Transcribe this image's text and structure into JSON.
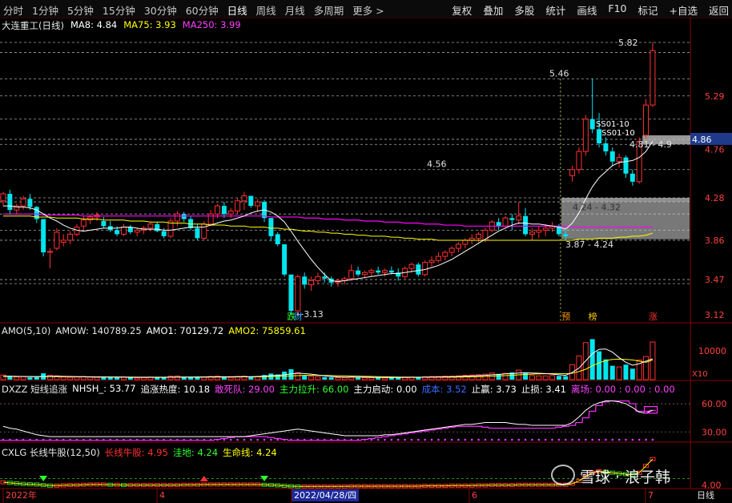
{
  "toolbar": {
    "periods": [
      "分时",
      "1分钟",
      "5分钟",
      "15分钟",
      "30分钟",
      "60分钟",
      "日线",
      "周线",
      "月线",
      "多周期",
      "更多 >"
    ],
    "active_period": "日线",
    "right_tools": [
      "复权",
      "叠加",
      "多股",
      "统计",
      "画线",
      "F10",
      "标记",
      "+自选",
      "返回"
    ]
  },
  "main_panel": {
    "stock_name": "大连重工(日线)",
    "ma8_label": "MA8: 4.84",
    "ma75_label": "MA75: 3.93",
    "ma250_label": "MA250: 3.99",
    "price_axis": [
      "5.29",
      "4.76",
      "4.28",
      "3.86",
      "3.47",
      "3.12"
    ],
    "current_price": "4.86",
    "ann_high": "5.82",
    "ann_546": "5.46",
    "ann_456": "4.56",
    "ann_low": "3.13",
    "ann_s1": "SS01-10",
    "ann_s2": "SS01-10",
    "ann_range1": "4.24 - 4.32",
    "ann_range2": "3.87 - 4.24",
    "ann_range3": "4.81 - 4.9",
    "tag_die": "跌",
    "tag_cai": "财",
    "tag_yu": "预",
    "tag_bang": "榜",
    "tag_zhang": "涨"
  },
  "amo_panel": {
    "title": "AMO(5,10)",
    "amow": "AMOW: 140789.25",
    "amo1": "AMO1: 70129.72",
    "amo2": "AMO2: 75859.61",
    "axis_label": "10000",
    "unit": "X10"
  },
  "dxzz_panel": {
    "title": "DXZZ 短线追涨",
    "nhsh": "NHSH_: 53.77",
    "zzrd": "追涨热度: 10.18",
    "gsj": "敢死队: 29.00",
    "zlls": "主力拉升: 66.00",
    "zlqd": "主力启动: 0.00",
    "cb": "成本: 3.52",
    "zy": "止赢: 3.73",
    "zs": "止损: 3.41",
    "lc": "离场: 0.00 : 0.00 : 0.00",
    "axis": [
      "60.00",
      "30.00"
    ]
  },
  "cxlg_panel": {
    "title": "CXLG 长线牛股(12,50)",
    "cxng": "长线牛股: 4.95",
    "wd": "洼地: 4.24",
    "smx": "生命线: 4.24",
    "axis": "4.00"
  },
  "xaxis": {
    "labels": [
      "2022年",
      "4",
      "2022/04/28/四",
      "6",
      "7"
    ],
    "period": "日线"
  },
  "watermark": "雪球 · 浪子韩",
  "colors": {
    "up": "#ff3030",
    "down": "#00e5ee",
    "ma8": "#ffffff",
    "ma75": "#ffff00",
    "ma250": "#ff00ff"
  },
  "chart_data": {
    "type": "candlestick",
    "candles": [
      [
        4.25,
        4.34,
        4.2,
        4.32
      ],
      [
        4.32,
        4.36,
        4.12,
        4.16
      ],
      [
        4.16,
        4.22,
        4.12,
        4.2
      ],
      [
        4.2,
        4.3,
        4.16,
        4.27
      ],
      [
        4.27,
        4.32,
        4.16,
        4.19
      ],
      [
        4.19,
        4.2,
        4.03,
        4.07
      ],
      [
        4.07,
        4.07,
        3.7,
        3.74
      ],
      [
        3.74,
        3.78,
        3.58,
        3.75
      ],
      [
        3.78,
        3.98,
        3.76,
        3.94
      ],
      [
        3.84,
        3.92,
        3.8,
        3.86
      ],
      [
        3.86,
        3.95,
        3.82,
        3.92
      ],
      [
        3.92,
        4.02,
        3.9,
        3.99
      ],
      [
        4.0,
        4.1,
        3.96,
        4.06
      ],
      [
        4.06,
        4.12,
        4.02,
        4.09
      ],
      [
        4.09,
        4.14,
        4.05,
        4.11
      ],
      [
        4.05,
        4.09,
        3.98,
        4.0
      ],
      [
        4.0,
        4.05,
        3.94,
        3.96
      ],
      [
        3.96,
        4.0,
        3.9,
        3.92
      ],
      [
        3.92,
        4.02,
        3.9,
        3.99
      ],
      [
        3.99,
        4.01,
        3.92,
        3.94
      ],
      [
        3.94,
        3.98,
        3.9,
        3.96
      ],
      [
        3.96,
        4.0,
        3.92,
        3.98
      ],
      [
        3.98,
        4.04,
        3.95,
        4.02
      ],
      [
        4.02,
        4.04,
        3.94,
        3.95
      ],
      [
        3.95,
        3.98,
        3.88,
        3.9
      ],
      [
        3.9,
        4.08,
        3.88,
        4.05
      ],
      [
        4.05,
        4.15,
        4.0,
        4.12
      ],
      [
        4.12,
        4.14,
        4.04,
        4.07
      ],
      [
        4.07,
        4.1,
        3.96,
        3.98
      ],
      [
        3.98,
        4.02,
        3.86,
        3.88
      ],
      [
        3.88,
        4.05,
        3.86,
        4.02
      ],
      [
        4.02,
        4.16,
        4.0,
        4.12
      ],
      [
        4.12,
        4.22,
        4.08,
        4.2
      ],
      [
        4.2,
        4.24,
        4.08,
        4.12
      ],
      [
        4.12,
        4.18,
        4.08,
        4.15
      ],
      [
        4.15,
        4.28,
        4.12,
        4.25
      ],
      [
        4.25,
        4.34,
        4.16,
        4.3
      ],
      [
        4.3,
        4.3,
        4.18,
        4.2
      ],
      [
        4.2,
        4.27,
        4.14,
        4.24
      ],
      [
        4.24,
        4.26,
        4.04,
        4.08
      ],
      [
        4.08,
        4.08,
        3.85,
        3.9
      ],
      [
        3.92,
        3.94,
        3.8,
        3.82
      ],
      [
        3.82,
        3.82,
        3.5,
        3.52
      ],
      [
        3.52,
        3.52,
        3.12,
        3.16
      ],
      [
        3.16,
        3.52,
        3.13,
        3.5
      ],
      [
        3.5,
        3.54,
        3.38,
        3.42
      ],
      [
        3.42,
        3.5,
        3.36,
        3.46
      ],
      [
        3.46,
        3.54,
        3.42,
        3.5
      ],
      [
        3.5,
        3.54,
        3.44,
        3.48
      ],
      [
        3.48,
        3.5,
        3.4,
        3.44
      ],
      [
        3.44,
        3.48,
        3.4,
        3.46
      ],
      [
        3.46,
        3.5,
        3.42,
        3.48
      ],
      [
        3.48,
        3.62,
        3.46,
        3.56
      ],
      [
        3.56,
        3.6,
        3.5,
        3.52
      ],
      [
        3.52,
        3.56,
        3.48,
        3.54
      ],
      [
        3.54,
        3.58,
        3.5,
        3.56
      ],
      [
        3.56,
        3.6,
        3.52,
        3.54
      ],
      [
        3.54,
        3.58,
        3.5,
        3.56
      ],
      [
        3.56,
        3.6,
        3.52,
        3.54
      ],
      [
        3.54,
        3.58,
        3.46,
        3.5
      ],
      [
        3.5,
        3.6,
        3.48,
        3.58
      ],
      [
        3.58,
        3.64,
        3.54,
        3.62
      ],
      [
        3.62,
        3.64,
        3.5,
        3.52
      ],
      [
        3.52,
        3.66,
        3.5,
        3.64
      ],
      [
        3.64,
        3.7,
        3.6,
        3.66
      ],
      [
        3.66,
        3.74,
        3.64,
        3.7
      ],
      [
        3.7,
        3.76,
        3.66,
        3.74
      ],
      [
        3.74,
        3.8,
        3.7,
        3.78
      ],
      [
        3.78,
        3.84,
        3.74,
        3.82
      ],
      [
        3.82,
        3.88,
        3.78,
        3.86
      ],
      [
        3.86,
        3.92,
        3.82,
        3.88
      ],
      [
        3.88,
        3.94,
        3.84,
        3.92
      ],
      [
        3.86,
        3.98,
        3.84,
        3.96
      ],
      [
        3.96,
        4.06,
        3.94,
        4.04
      ],
      [
        4.04,
        4.08,
        3.96,
        4.0
      ],
      [
        4.0,
        4.1,
        3.98,
        4.08
      ],
      [
        4.08,
        4.12,
        3.96,
        4.06
      ],
      [
        4.06,
        4.24,
        4.02,
        4.1
      ],
      [
        4.1,
        4.18,
        3.9,
        3.92
      ],
      [
        3.92,
        3.98,
        3.86,
        3.94
      ],
      [
        3.94,
        4.0,
        3.88,
        3.96
      ],
      [
        3.96,
        4.02,
        3.9,
        3.98
      ],
      [
        3.98,
        4.04,
        3.94,
        4.0
      ],
      [
        4.0,
        4.02,
        3.9,
        3.92
      ],
      [
        3.92,
        3.96,
        3.86,
        3.9
      ],
      [
        4.5,
        4.6,
        4.44,
        4.56
      ],
      [
        4.56,
        4.78,
        4.52,
        4.74
      ],
      [
        4.74,
        5.1,
        4.7,
        5.06
      ],
      [
        5.06,
        5.46,
        4.92,
        4.96
      ],
      [
        4.96,
        5.12,
        4.78,
        4.82
      ],
      [
        4.82,
        4.88,
        4.7,
        4.74
      ],
      [
        4.74,
        4.78,
        4.6,
        4.64
      ],
      [
        4.64,
        4.72,
        4.58,
        4.68
      ],
      [
        4.68,
        4.7,
        4.48,
        4.52
      ],
      [
        4.52,
        4.56,
        4.4,
        4.44
      ],
      [
        4.44,
        4.88,
        4.42,
        4.84
      ],
      [
        4.9,
        5.26,
        4.86,
        5.2
      ],
      [
        5.2,
        5.82,
        5.18,
        5.74
      ]
    ],
    "ma8": [
      4.2,
      4.2,
      4.19,
      4.19,
      4.18,
      4.16,
      4.12,
      4.08,
      4.05,
      4.01,
      3.98,
      3.96,
      3.95,
      3.96,
      3.97,
      3.98,
      3.98,
      3.98,
      3.99,
      3.99,
      3.98,
      3.97,
      3.97,
      3.97,
      3.96,
      3.96,
      3.97,
      3.98,
      3.99,
      3.99,
      3.99,
      4.01,
      4.03,
      4.05,
      4.06,
      4.08,
      4.1,
      4.13,
      4.15,
      4.16,
      4.14,
      4.1,
      4.04,
      3.95,
      3.85,
      3.76,
      3.67,
      3.59,
      3.52,
      3.46,
      3.45,
      3.46,
      3.47,
      3.48,
      3.49,
      3.5,
      3.51,
      3.52,
      3.53,
      3.53,
      3.54,
      3.55,
      3.56,
      3.57,
      3.59,
      3.61,
      3.64,
      3.67,
      3.71,
      3.75,
      3.79,
      3.83,
      3.87,
      3.91,
      3.95,
      3.98,
      4.01,
      4.03,
      4.03,
      4.02,
      4.02,
      4.01,
      4.0,
      3.99,
      3.97,
      4.03,
      4.13,
      4.27,
      4.39,
      4.48,
      4.54,
      4.6,
      4.63,
      4.64,
      4.65,
      4.68,
      4.74,
      4.84
    ],
    "ma75": [
      4.1,
      4.1,
      4.1,
      4.1,
      4.1,
      4.09,
      4.09,
      4.09,
      4.08,
      4.08,
      4.08,
      4.08,
      4.07,
      4.07,
      4.07,
      4.06,
      4.06,
      4.06,
      4.06,
      4.05,
      4.05,
      4.05,
      4.04,
      4.04,
      4.04,
      4.03,
      4.03,
      4.03,
      4.02,
      4.02,
      4.02,
      4.01,
      4.01,
      4.01,
      4.0,
      4.0,
      4.0,
      3.99,
      3.99,
      3.99,
      3.98,
      3.98,
      3.97,
      3.97,
      3.96,
      3.95,
      3.95,
      3.94,
      3.94,
      3.93,
      3.93,
      3.92,
      3.92,
      3.91,
      3.91,
      3.9,
      3.9,
      3.9,
      3.89,
      3.89,
      3.88,
      3.88,
      3.87,
      3.87,
      3.87,
      3.86,
      3.86,
      3.86,
      3.86,
      3.86,
      3.86,
      3.86,
      3.86,
      3.86,
      3.86,
      3.86,
      3.86,
      3.86,
      3.86,
      3.86,
      3.86,
      3.86,
      3.86,
      3.86,
      3.86,
      3.86,
      3.87,
      3.87,
      3.87,
      3.88,
      3.88,
      3.88,
      3.89,
      3.89,
      3.9,
      3.9,
      3.91,
      3.93
    ],
    "ma250": [
      4.12,
      4.12,
      4.12,
      4.12,
      4.12,
      4.12,
      4.11,
      4.11,
      4.11,
      4.11,
      4.11,
      4.11,
      4.1,
      4.1,
      4.1,
      4.1,
      4.1,
      4.1,
      4.1,
      4.1,
      4.1,
      4.1,
      4.1,
      4.1,
      4.1,
      4.1,
      4.1,
      4.1,
      4.1,
      4.1,
      4.1,
      4.1,
      4.1,
      4.1,
      4.1,
      4.1,
      4.1,
      4.1,
      4.1,
      4.1,
      4.09,
      4.09,
      4.09,
      4.09,
      4.09,
      4.08,
      4.08,
      4.08,
      4.07,
      4.07,
      4.07,
      4.06,
      4.06,
      4.06,
      4.05,
      4.05,
      4.05,
      4.04,
      4.04,
      4.04,
      4.03,
      4.03,
      4.03,
      4.02,
      4.02,
      4.02,
      4.01,
      4.01,
      4.01,
      4.0,
      4.0,
      4.0,
      4.0,
      4.0,
      4.0,
      4.0,
      4.0,
      4.0,
      4.0,
      4.0,
      4.0,
      4.0,
      4.0,
      4.0,
      4.0,
      3.99,
      3.99,
      3.99,
      3.99,
      3.99,
      3.99,
      3.99,
      3.99,
      3.99,
      3.99,
      3.99,
      3.99,
      3.99
    ],
    "price_range": [
      3.05,
      6.05
    ],
    "hlines": [
      5.82,
      5.72,
      5.46,
      5.29,
      5.06,
      4.86,
      4.81,
      4.56,
      4.28,
      4.24,
      4.12,
      3.96,
      3.86,
      3.47,
      3.43
    ],
    "volume_range": [
      0,
      15500
    ],
    "volumes": [
      1600,
      1200,
      900,
      1000,
      800,
      900,
      2200,
      1500,
      1300,
      900,
      800,
      900,
      1100,
      900,
      800,
      800,
      700,
      700,
      900,
      700,
      600,
      700,
      900,
      800,
      700,
      1200,
      1300,
      900,
      800,
      900,
      900,
      1100,
      1200,
      900,
      800,
      1100,
      1200,
      900,
      1000,
      1600,
      2100,
      1800,
      2800,
      3600,
      2400,
      1400,
      1100,
      1000,
      900,
      800,
      700,
      700,
      1100,
      800,
      700,
      700,
      700,
      600,
      700,
      800,
      900,
      900,
      800,
      1000,
      1100,
      1100,
      1200,
      1200,
      1300,
      1500,
      1600,
      1700,
      1900,
      2300,
      2000,
      2200,
      2500,
      3300,
      2400,
      1400,
      1300,
      1300,
      1400,
      1300,
      1200,
      5200,
      8200,
      12800,
      14000,
      9800,
      7000,
      4800,
      4400,
      5200,
      3800,
      6800,
      8000,
      13000
    ],
    "amo1": [
      1200,
      1200,
      1150,
      1100,
      1050,
      1050,
      1100,
      1150,
      1200,
      1150,
      1100,
      1050,
      1000,
      950,
      900,
      900,
      850,
      850,
      850,
      800,
      800,
      800,
      800,
      800,
      800,
      850,
      900,
      900,
      900,
      950,
      950,
      1000,
      1000,
      1000,
      1000,
      1050,
      1050,
      1050,
      1100,
      1200,
      1400,
      1500,
      1700,
      2000,
      2200,
      2100,
      1900,
      1600,
      1300,
      1100,
      950,
      850,
      850,
      850,
      850,
      800,
      750,
      750,
      750,
      750,
      750,
      800,
      800,
      850,
      900,
      950,
      1000,
      1050,
      1100,
      1200,
      1300,
      1400,
      1500,
      1700,
      1800,
      2000,
      2100,
      2300,
      2400,
      2300,
      2200,
      2100,
      1900,
      1700,
      1500,
      2500,
      4000,
      6500,
      9000,
      10500,
      10600,
      9500,
      7600,
      6000,
      5000,
      5500,
      6400,
      7200
    ],
    "amo2": [
      1100,
      1100,
      1100,
      1100,
      1100,
      1050,
      1050,
      1050,
      1050,
      1050,
      1050,
      1000,
      1000,
      1000,
      980,
      960,
      940,
      920,
      900,
      890,
      880,
      870,
      860,
      850,
      850,
      850,
      850,
      860,
      860,
      870,
      880,
      890,
      900,
      910,
      920,
      940,
      960,
      980,
      1000,
      1050,
      1100,
      1150,
      1200,
      1300,
      1400,
      1500,
      1500,
      1500,
      1450,
      1400,
      1350,
      1300,
      1250,
      1200,
      1150,
      1100,
      1050,
      1000,
      950,
      900,
      880,
      860,
      850,
      850,
      850,
      860,
      870,
      880,
      900,
      950,
      1000,
      1050,
      1100,
      1200,
      1300,
      1400,
      1500,
      1650,
      1800,
      1900,
      2000,
      2050,
      2100,
      2100,
      2050,
      2200,
      2800,
      3600,
      4800,
      5800,
      6600,
      7000,
      7100,
      7000,
      6800,
      6400,
      6000,
      6800
    ],
    "dxzz_range": [
      20,
      72
    ],
    "nhsh": [
      36,
      34,
      33,
      31,
      29,
      27,
      26,
      25,
      25,
      25,
      25,
      25,
      25,
      25,
      25,
      25,
      25,
      25,
      25,
      25,
      25,
      25,
      25,
      25,
      25,
      25,
      25,
      25,
      25,
      25,
      25,
      25,
      25,
      25,
      25,
      25,
      25,
      26,
      27,
      28,
      29,
      30,
      31,
      32,
      33,
      32,
      31,
      30,
      29,
      28,
      27,
      26,
      26,
      26,
      26,
      26,
      26,
      27,
      27,
      28,
      29,
      30,
      31,
      32,
      33,
      34,
      35,
      36,
      37,
      38,
      38,
      39,
      40,
      40,
      40,
      40,
      39,
      38,
      38,
      37,
      37,
      37,
      37,
      37,
      37,
      40,
      46,
      53,
      58,
      61,
      63,
      63,
      62,
      60,
      56,
      51,
      50,
      53
    ],
    "dxzz_step": [
      21,
      21,
      21,
      21,
      21,
      21,
      21,
      21,
      21,
      21,
      21,
      21,
      21,
      21,
      21,
      21,
      21,
      21,
      21,
      21,
      21,
      21,
      21,
      21,
      21,
      21,
      21,
      21,
      21,
      21,
      21,
      21,
      22,
      23,
      24,
      25,
      25,
      25,
      25,
      25,
      24,
      23,
      22,
      21,
      21,
      21,
      21,
      21,
      21,
      21,
      21,
      21,
      21,
      21,
      22,
      23,
      24,
      25,
      26,
      27,
      28,
      29,
      30,
      31,
      32,
      33,
      34,
      35,
      36,
      36,
      36,
      36,
      35,
      34,
      34,
      34,
      34,
      34,
      34,
      34,
      34,
      34,
      34,
      35,
      36,
      37,
      40,
      45,
      52,
      58,
      62,
      63,
      63,
      63,
      60,
      52,
      52,
      53
    ],
    "cxlg_range": [
      3.9,
      5.1
    ],
    "cxlg": [
      4.1,
      4.08,
      4.06,
      4.04,
      4.03,
      4.02,
      4.0,
      3.98,
      3.98,
      3.99,
      4.0,
      4.0,
      4.01,
      4.02,
      4.02,
      4.02,
      4.01,
      4.01,
      4.0,
      4.0,
      4.0,
      4.0,
      4.0,
      4.0,
      4.0,
      4.0,
      4.0,
      4.01,
      4.01,
      4.01,
      4.02,
      4.02,
      4.02,
      4.02,
      4.02,
      4.02,
      4.02,
      4.02,
      4.02,
      4.01,
      4.0,
      3.99,
      3.97,
      3.96,
      3.95,
      3.95,
      3.95,
      3.95,
      3.95,
      3.95,
      3.95,
      3.95,
      3.96,
      3.96,
      3.96,
      3.96,
      3.96,
      3.96,
      3.96,
      3.96,
      3.96,
      3.96,
      3.96,
      3.97,
      3.97,
      3.97,
      3.97,
      3.98,
      3.98,
      3.98,
      3.98,
      3.99,
      3.99,
      4.0,
      4.0,
      4.0,
      4.0,
      4.01,
      4.01,
      4.01,
      4.01,
      4.01,
      4.01,
      4.01,
      4.01,
      4.05,
      4.15,
      4.3,
      4.45,
      4.5,
      4.48,
      4.45,
      4.42,
      4.4,
      4.38,
      4.45,
      4.7,
      4.95
    ],
    "cxlg_wd": 4.24
  }
}
